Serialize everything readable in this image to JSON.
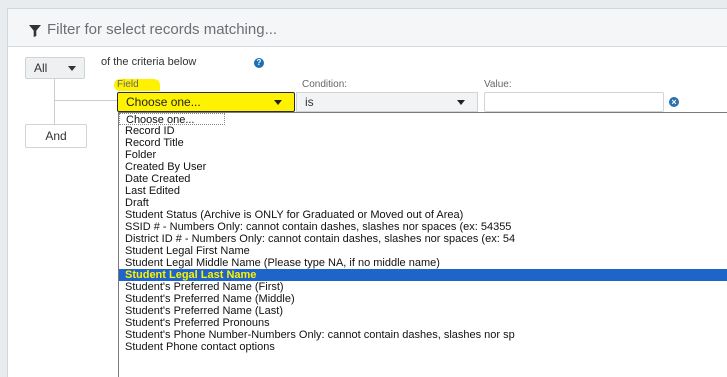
{
  "header": {
    "title": "Filter for select records matching..."
  },
  "criteria": {
    "match_select": "All",
    "description": "of the criteria below",
    "and_label": "And"
  },
  "row": {
    "field_label": "Field",
    "condition_label": "Condition:",
    "value_label": "Value:",
    "field_selected": "Choose one...",
    "condition_selected": "is",
    "value": ""
  },
  "dropdown": {
    "options": [
      "Choose one...",
      "Record ID",
      "Record Title",
      "Folder",
      "Created By User",
      "Date Created",
      "Last Edited",
      "Draft",
      "Student Status (Archive is ONLY for Graduated or Moved out of Area)",
      "SSID # - Numbers Only: cannot contain dashes, slashes nor spaces (ex: 54355",
      "District ID # - Numbers Only: cannot contain dashes, slashes nor spaces (ex: 54",
      "Student Legal First Name",
      "Student Legal Middle Name (Please type NA, if no middle name)",
      "Student Legal Last Name",
      "Student's Preferred Name (First)",
      "Student's Preferred Name (Middle)",
      "Student's Preferred Name (Last)",
      "Student's Preferred Pronouns",
      "Student's Phone Number-Numbers Only: cannot contain dashes, slashes nor sp",
      "Student Phone contact options"
    ],
    "selected_index": 13
  },
  "colors": {
    "highlight": "#fff200",
    "selected_option_bg": "#1f64c8",
    "icon_blue": "#2a6fb0"
  }
}
